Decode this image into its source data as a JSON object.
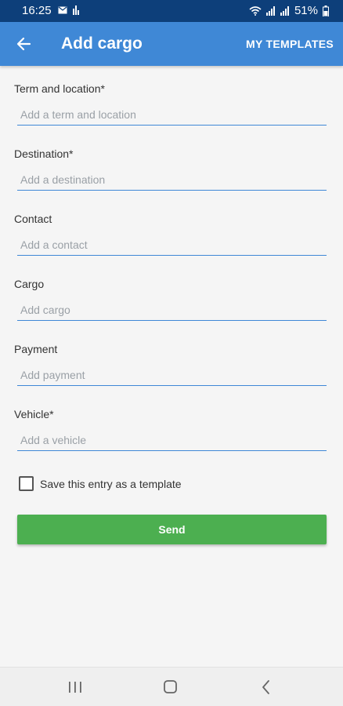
{
  "status_bar": {
    "time": "16:25",
    "battery": "51%"
  },
  "app_bar": {
    "title": "Add cargo",
    "templates_label": "MY TEMPLATES",
    "back_icon": "arrow-left-icon"
  },
  "form": {
    "fields": [
      {
        "label": "Term and location*",
        "placeholder": "Add a term and location"
      },
      {
        "label": "Destination*",
        "placeholder": "Add a destination"
      },
      {
        "label": "Contact",
        "placeholder": "Add a contact"
      },
      {
        "label": "Cargo",
        "placeholder": "Add cargo"
      },
      {
        "label": "Payment",
        "placeholder": "Add payment"
      },
      {
        "label": "Vehicle*",
        "placeholder": "Add a vehicle"
      }
    ],
    "save_template_label": "Save this entry as a template",
    "save_template_checked": false,
    "send_label": "Send"
  },
  "colors": {
    "status_bar": "#0d3f7a",
    "app_bar": "#3f88d6",
    "send_button": "#4caf50"
  }
}
